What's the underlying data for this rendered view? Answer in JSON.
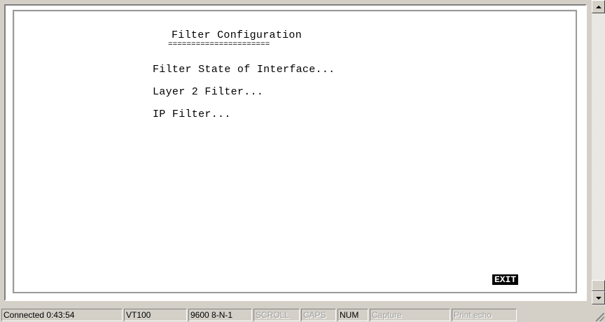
{
  "terminal": {
    "title": "Filter Configuration",
    "title_underline": "======================",
    "menu": [
      "Filter State of Interface...",
      "Layer 2 Filter...",
      "IP Filter..."
    ],
    "exit_label": "EXIT"
  },
  "status_bar": {
    "connected": "Connected 0:43:54",
    "emulation": "VT100",
    "port_settings": "9600 8-N-1",
    "scroll": "SCROLL",
    "caps": "CAPS",
    "num": "NUM",
    "capture": "Capture",
    "print_echo": "Print echo"
  },
  "icons": {
    "scroll_up": "scroll-up-arrow",
    "scroll_down": "scroll-down-arrow",
    "size_grip": "resize-grip"
  }
}
